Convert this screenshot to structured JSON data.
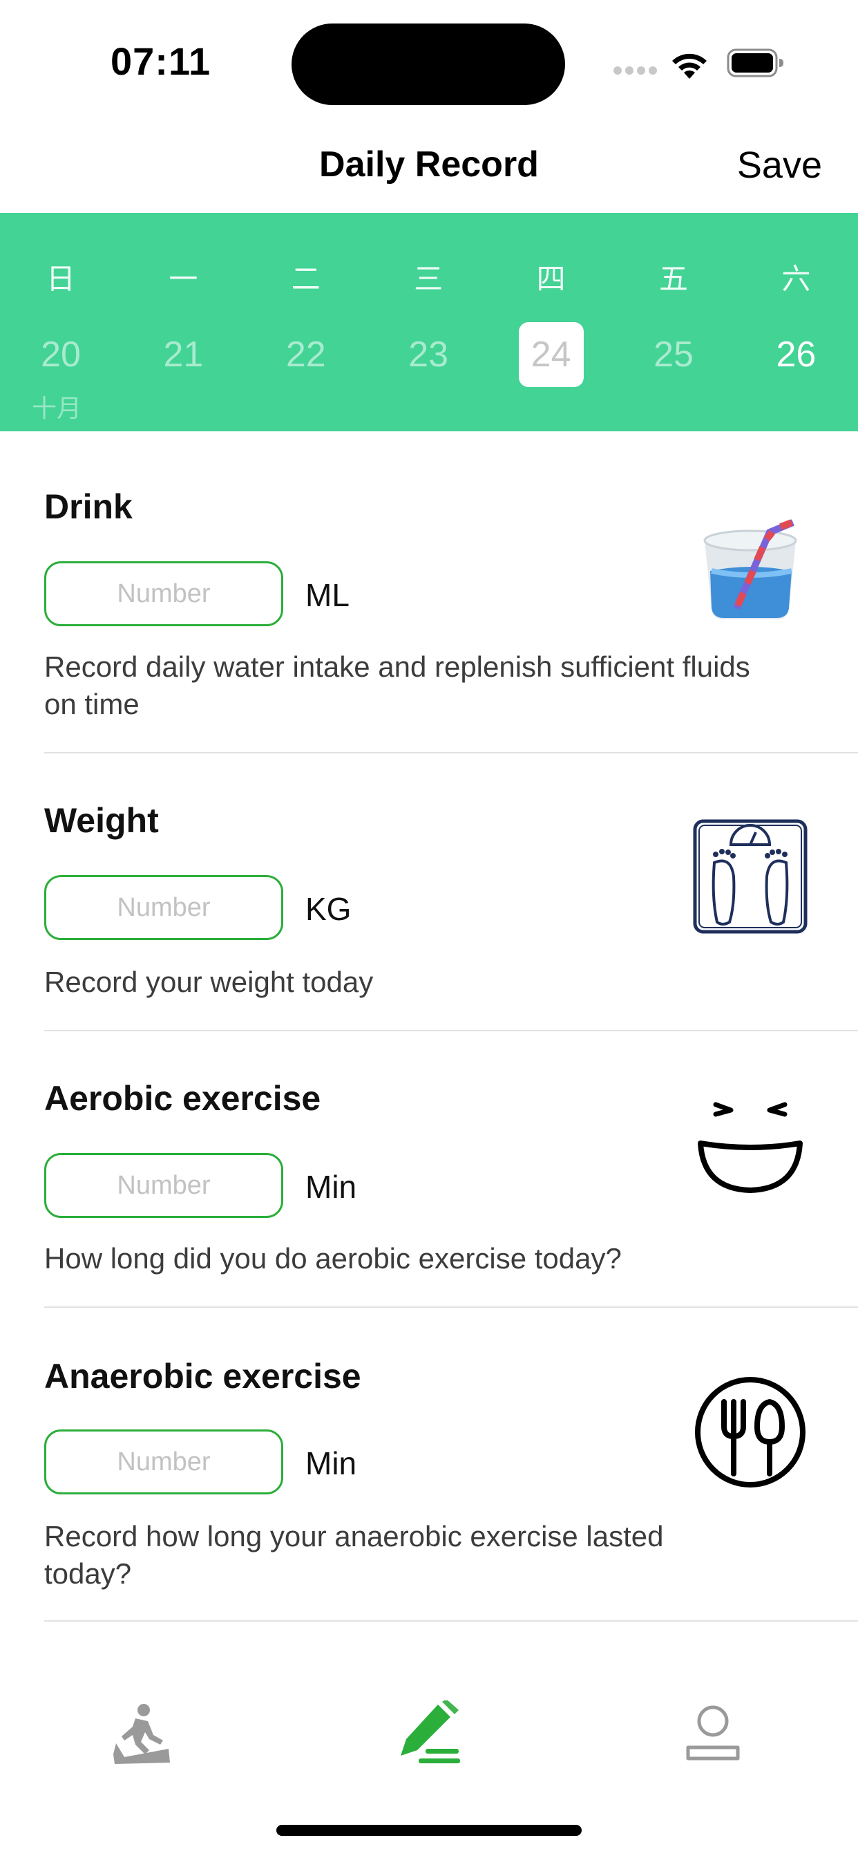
{
  "status_bar": {
    "time": "07:11"
  },
  "nav": {
    "title": "Daily Record",
    "save_label": "Save"
  },
  "calendar": {
    "accent_color": "#42d395",
    "weekdays": [
      "日",
      "一",
      "二",
      "三",
      "四",
      "五",
      "六"
    ],
    "days": [
      "20",
      "21",
      "22",
      "23",
      "24",
      "25",
      "26"
    ],
    "selected_day": "24",
    "today": "26",
    "month_label": "十月"
  },
  "records": [
    {
      "title": "Drink",
      "placeholder": "Number",
      "unit": "ML",
      "description": "Record daily water intake and replenish sufficient fluids on time",
      "icon": "water-glass-icon"
    },
    {
      "title": "Weight",
      "placeholder": "Number",
      "unit": "KG",
      "description": "Record your weight today",
      "icon": "weight-scale-icon"
    },
    {
      "title": "Aerobic exercise",
      "placeholder": "Number",
      "unit": "Min",
      "description": "How long did you do aerobic exercise today?",
      "icon": "laughing-face-icon"
    },
    {
      "title": "Anaerobic exercise",
      "placeholder": "Number",
      "unit": "Min",
      "description": "Record how long your anaerobic exercise lasted today?",
      "icon": "fork-spoon-icon"
    }
  ],
  "tab_bar": {
    "active_color": "#2bae3a",
    "inactive_color": "#9a9a9a",
    "tabs": [
      {
        "icon": "treadmill-icon",
        "active": false
      },
      {
        "icon": "edit-pencil-icon",
        "active": true
      },
      {
        "icon": "profile-icon",
        "active": false
      }
    ]
  }
}
